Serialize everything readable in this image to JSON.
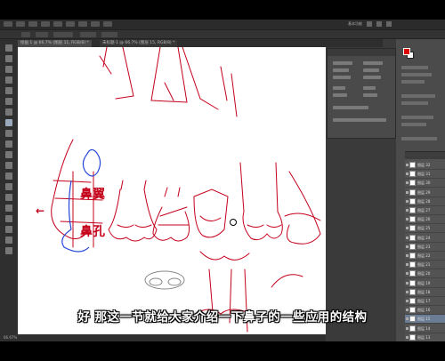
{
  "tabs": [
    {
      "label": "绘画 1 @ 66.7% (图层 11, RGB/8) *"
    },
    {
      "label": "未标题-1 @ 66.7% (图层 15, RGB/8) *"
    }
  ],
  "workspace": {
    "label": "基本功能"
  },
  "status": {
    "zoom": "66.67%"
  },
  "canvas": {
    "labels": {
      "nose_wing": "鼻翼",
      "nostril": "鼻孔"
    },
    "arrow": "←"
  },
  "layers": {
    "items": [
      {
        "name": "图层 32"
      },
      {
        "name": "图层 31"
      },
      {
        "name": "图层 30"
      },
      {
        "name": "图层 29"
      },
      {
        "name": "图层 28"
      },
      {
        "name": "图层 27"
      },
      {
        "name": "图层 26"
      },
      {
        "name": "图层 25"
      },
      {
        "name": "图层 24"
      },
      {
        "name": "图层 23"
      },
      {
        "name": "图层 22"
      },
      {
        "name": "图层 21"
      },
      {
        "name": "图层 20"
      },
      {
        "name": "图层 19"
      },
      {
        "name": "图层 18"
      },
      {
        "name": "图层 17"
      },
      {
        "name": "图层 16"
      },
      {
        "name": "图层 15"
      },
      {
        "name": "图层 14"
      },
      {
        "name": "图层 13"
      }
    ]
  },
  "subtitle": "好  那这一节就给大家介绍一下鼻子的一些应用的结构",
  "colors": {
    "sketch": "#c4001a",
    "blue_sketch": "#2446d8",
    "foreground": "#dd0000"
  }
}
